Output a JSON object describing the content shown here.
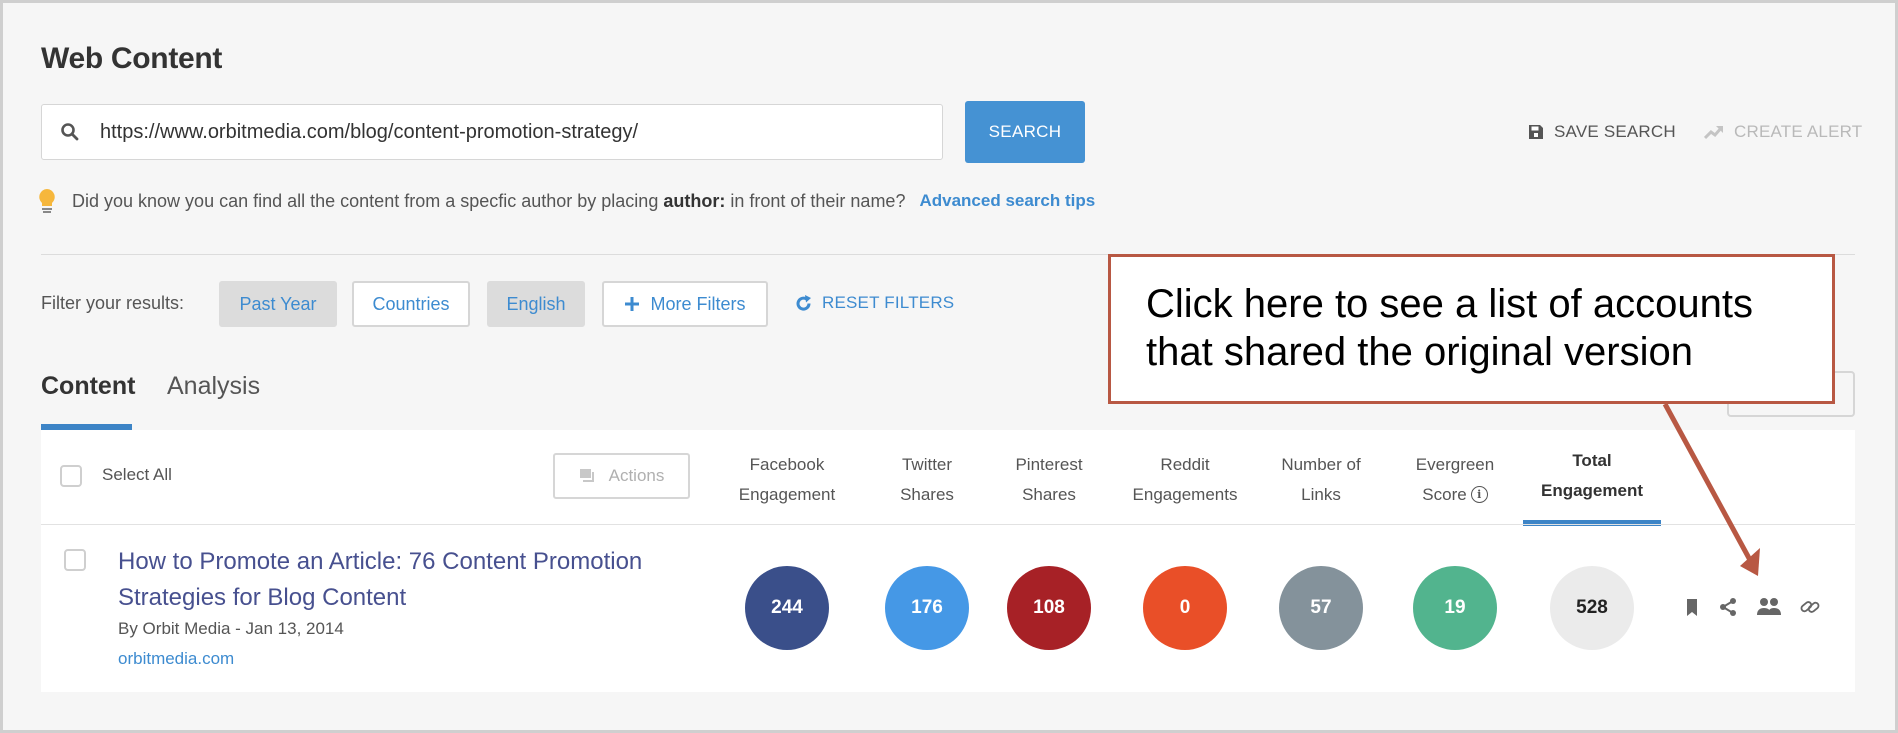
{
  "page": {
    "title": "Web Content"
  },
  "search": {
    "value": "https://www.orbitmedia.com/blog/content-promotion-strategy/",
    "button_label": "SEARCH",
    "icon": "search-icon"
  },
  "header_actions": {
    "save_search": "SAVE SEARCH",
    "create_alert": "CREATE ALERT"
  },
  "tip": {
    "prefix": "Did you know you can find all the content from a specfic author by placing",
    "keyword": "author:",
    "suffix": "in front of their name?",
    "link": "Advanced search tips"
  },
  "filters": {
    "label": "Filter your results:",
    "items": [
      {
        "label": "Past Year",
        "active": true
      },
      {
        "label": "Countries",
        "active": false
      },
      {
        "label": "English",
        "active": true
      },
      {
        "label": "More Filters",
        "active": false
      }
    ],
    "reset_label": "RESET FILTERS"
  },
  "tabs": [
    {
      "label": "Content",
      "active": true
    },
    {
      "label": "Analysis",
      "active": false
    }
  ],
  "table": {
    "select_all": "Select All",
    "actions_label": "Actions",
    "columns": [
      {
        "line1": "Facebook",
        "line2": "Engagement"
      },
      {
        "line1": "Twitter",
        "line2": "Shares"
      },
      {
        "line1": "Pinterest",
        "line2": "Shares"
      },
      {
        "line1": "Reddit",
        "line2": "Engagements"
      },
      {
        "line1": "Number of",
        "line2": "Links"
      },
      {
        "line1": "Evergreen",
        "line2": "Score"
      },
      {
        "line1": "Total",
        "line2": "Engagement"
      }
    ],
    "rows": [
      {
        "title": "How to Promote an Article: 76 Content Promotion Strategies for Blog Content",
        "meta": "By Orbit Media - Jan 13, 2014",
        "domain": "orbitmedia.com",
        "metrics": {
          "facebook": "244",
          "twitter": "176",
          "pinterest": "108",
          "reddit": "0",
          "links": "57",
          "evergreen": "19",
          "total": "528"
        },
        "icons": [
          "bookmark-icon",
          "share-icon",
          "sharers-icon",
          "link-icon"
        ]
      }
    ]
  },
  "colors": {
    "accent": "#4592d3",
    "facebook": "#3a4f8a",
    "twitter": "#4598e6",
    "pinterest": "#a72126",
    "reddit": "#e94f28",
    "links": "#84929b",
    "evergreen": "#52b48e",
    "total": "#ebebeb",
    "annotation": "#b85843"
  },
  "annotation": {
    "text": "Click here to see a list of accounts that shared the original version"
  }
}
